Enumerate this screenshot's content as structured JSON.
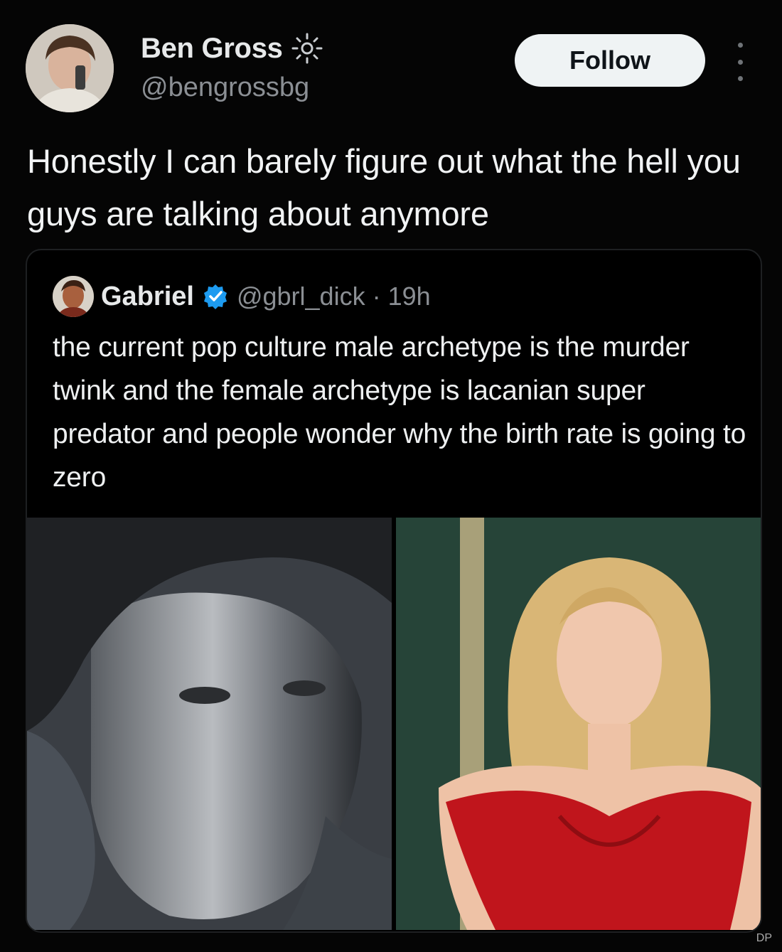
{
  "tweet": {
    "author": {
      "name": "Ben Gross",
      "handle": "@bengrossbg",
      "name_icon": "sun-icon",
      "avatar_alt": "avatar"
    },
    "follow_label": "Follow",
    "more_icon": "more-dots-icon",
    "text": "Honestly I can barely figure out what the hell you guys are talking about anymore"
  },
  "quote": {
    "author": {
      "name": "Gabriel",
      "verified_icon": "verified-badge-icon",
      "handle": "@gbrl_dick",
      "time": "· 19h"
    },
    "text": "the current pop culture male archetype is the murder twink and the female archetype is lacanian super predator and people wonder why the birth rate is going to zero",
    "media": [
      {
        "name": "photo-left"
      },
      {
        "name": "photo-right"
      }
    ]
  },
  "watermark": "DP",
  "colors": {
    "background": "#050505",
    "text_primary": "#e7e9ea",
    "text_secondary": "#8b8f94",
    "verified_blue": "#1d9bf0",
    "follow_bg": "#eff3f4"
  }
}
